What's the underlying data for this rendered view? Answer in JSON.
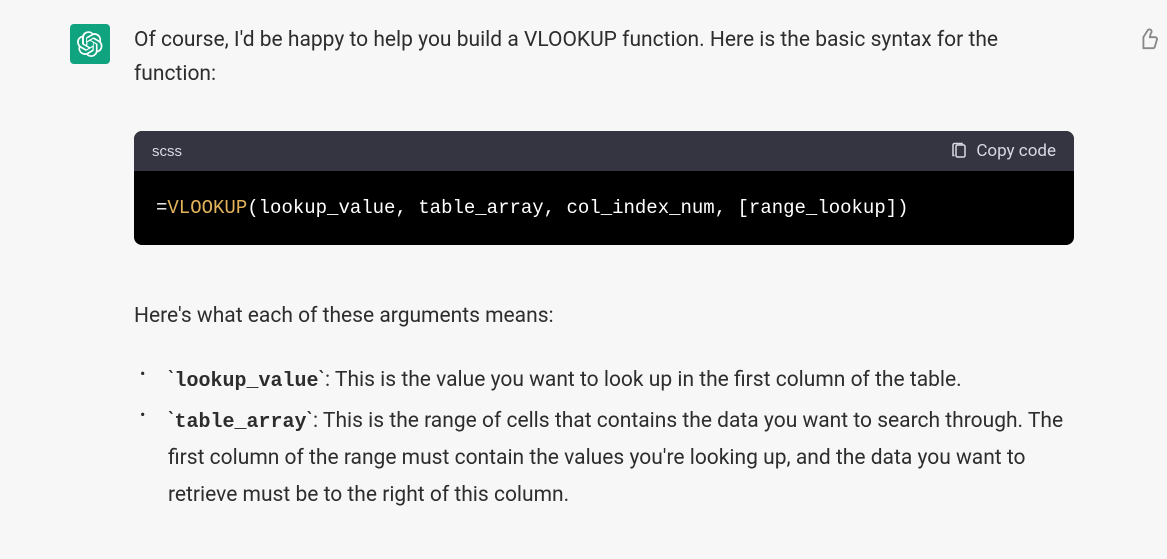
{
  "message": {
    "intro": "Of course, I'd be happy to help you build a VLOOKUP function. Here is the basic syntax for the function:",
    "code": {
      "lang": "scss",
      "copy_label": "Copy code",
      "eq": "=",
      "fn": "VLOOKUP",
      "args": "(lookup_value, table_array, col_index_num, [range_lookup])"
    },
    "desc": "Here's what each of these arguments means:",
    "args_list": [
      {
        "name": "lookup_value",
        "text": ": This is the value you want to look up in the first column of the table."
      },
      {
        "name": "table_array",
        "text": ": This is the range of cells that contains the data you want to search through. The first column of the range must contain the values you're looking up, and the data you want to retrieve must be to the right of this column."
      }
    ]
  }
}
